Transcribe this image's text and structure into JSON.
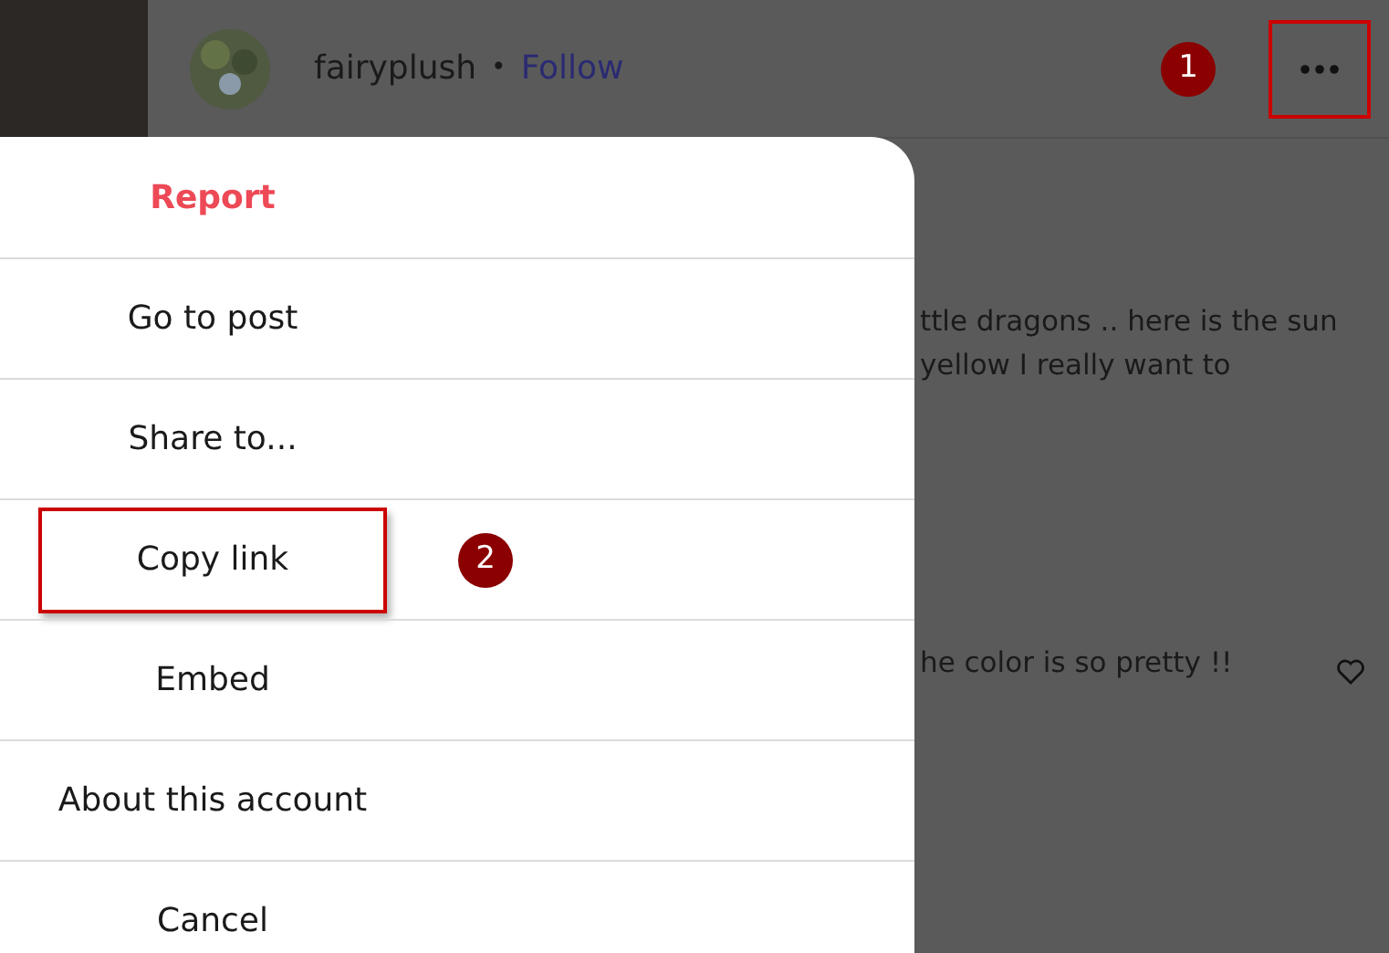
{
  "post_header": {
    "username": "fairyplush",
    "separator": "•",
    "follow": "Follow",
    "callout": "1"
  },
  "comments": [
    {
      "text": "ttle dragons .. here is the sun"
    },
    {
      "text": "yellow I really want to"
    },
    {
      "text": "he color is so pretty !!"
    }
  ],
  "menu": [
    {
      "label": "Report",
      "kind": "danger"
    },
    {
      "label": "Go to post",
      "kind": "normal"
    },
    {
      "label": "Share to...",
      "kind": "normal"
    },
    {
      "label": "Copy link",
      "kind": "normal",
      "callout": "2"
    },
    {
      "label": "Embed",
      "kind": "normal"
    },
    {
      "label": "About this account",
      "kind": "normal"
    },
    {
      "label": "Cancel",
      "kind": "normal"
    }
  ]
}
